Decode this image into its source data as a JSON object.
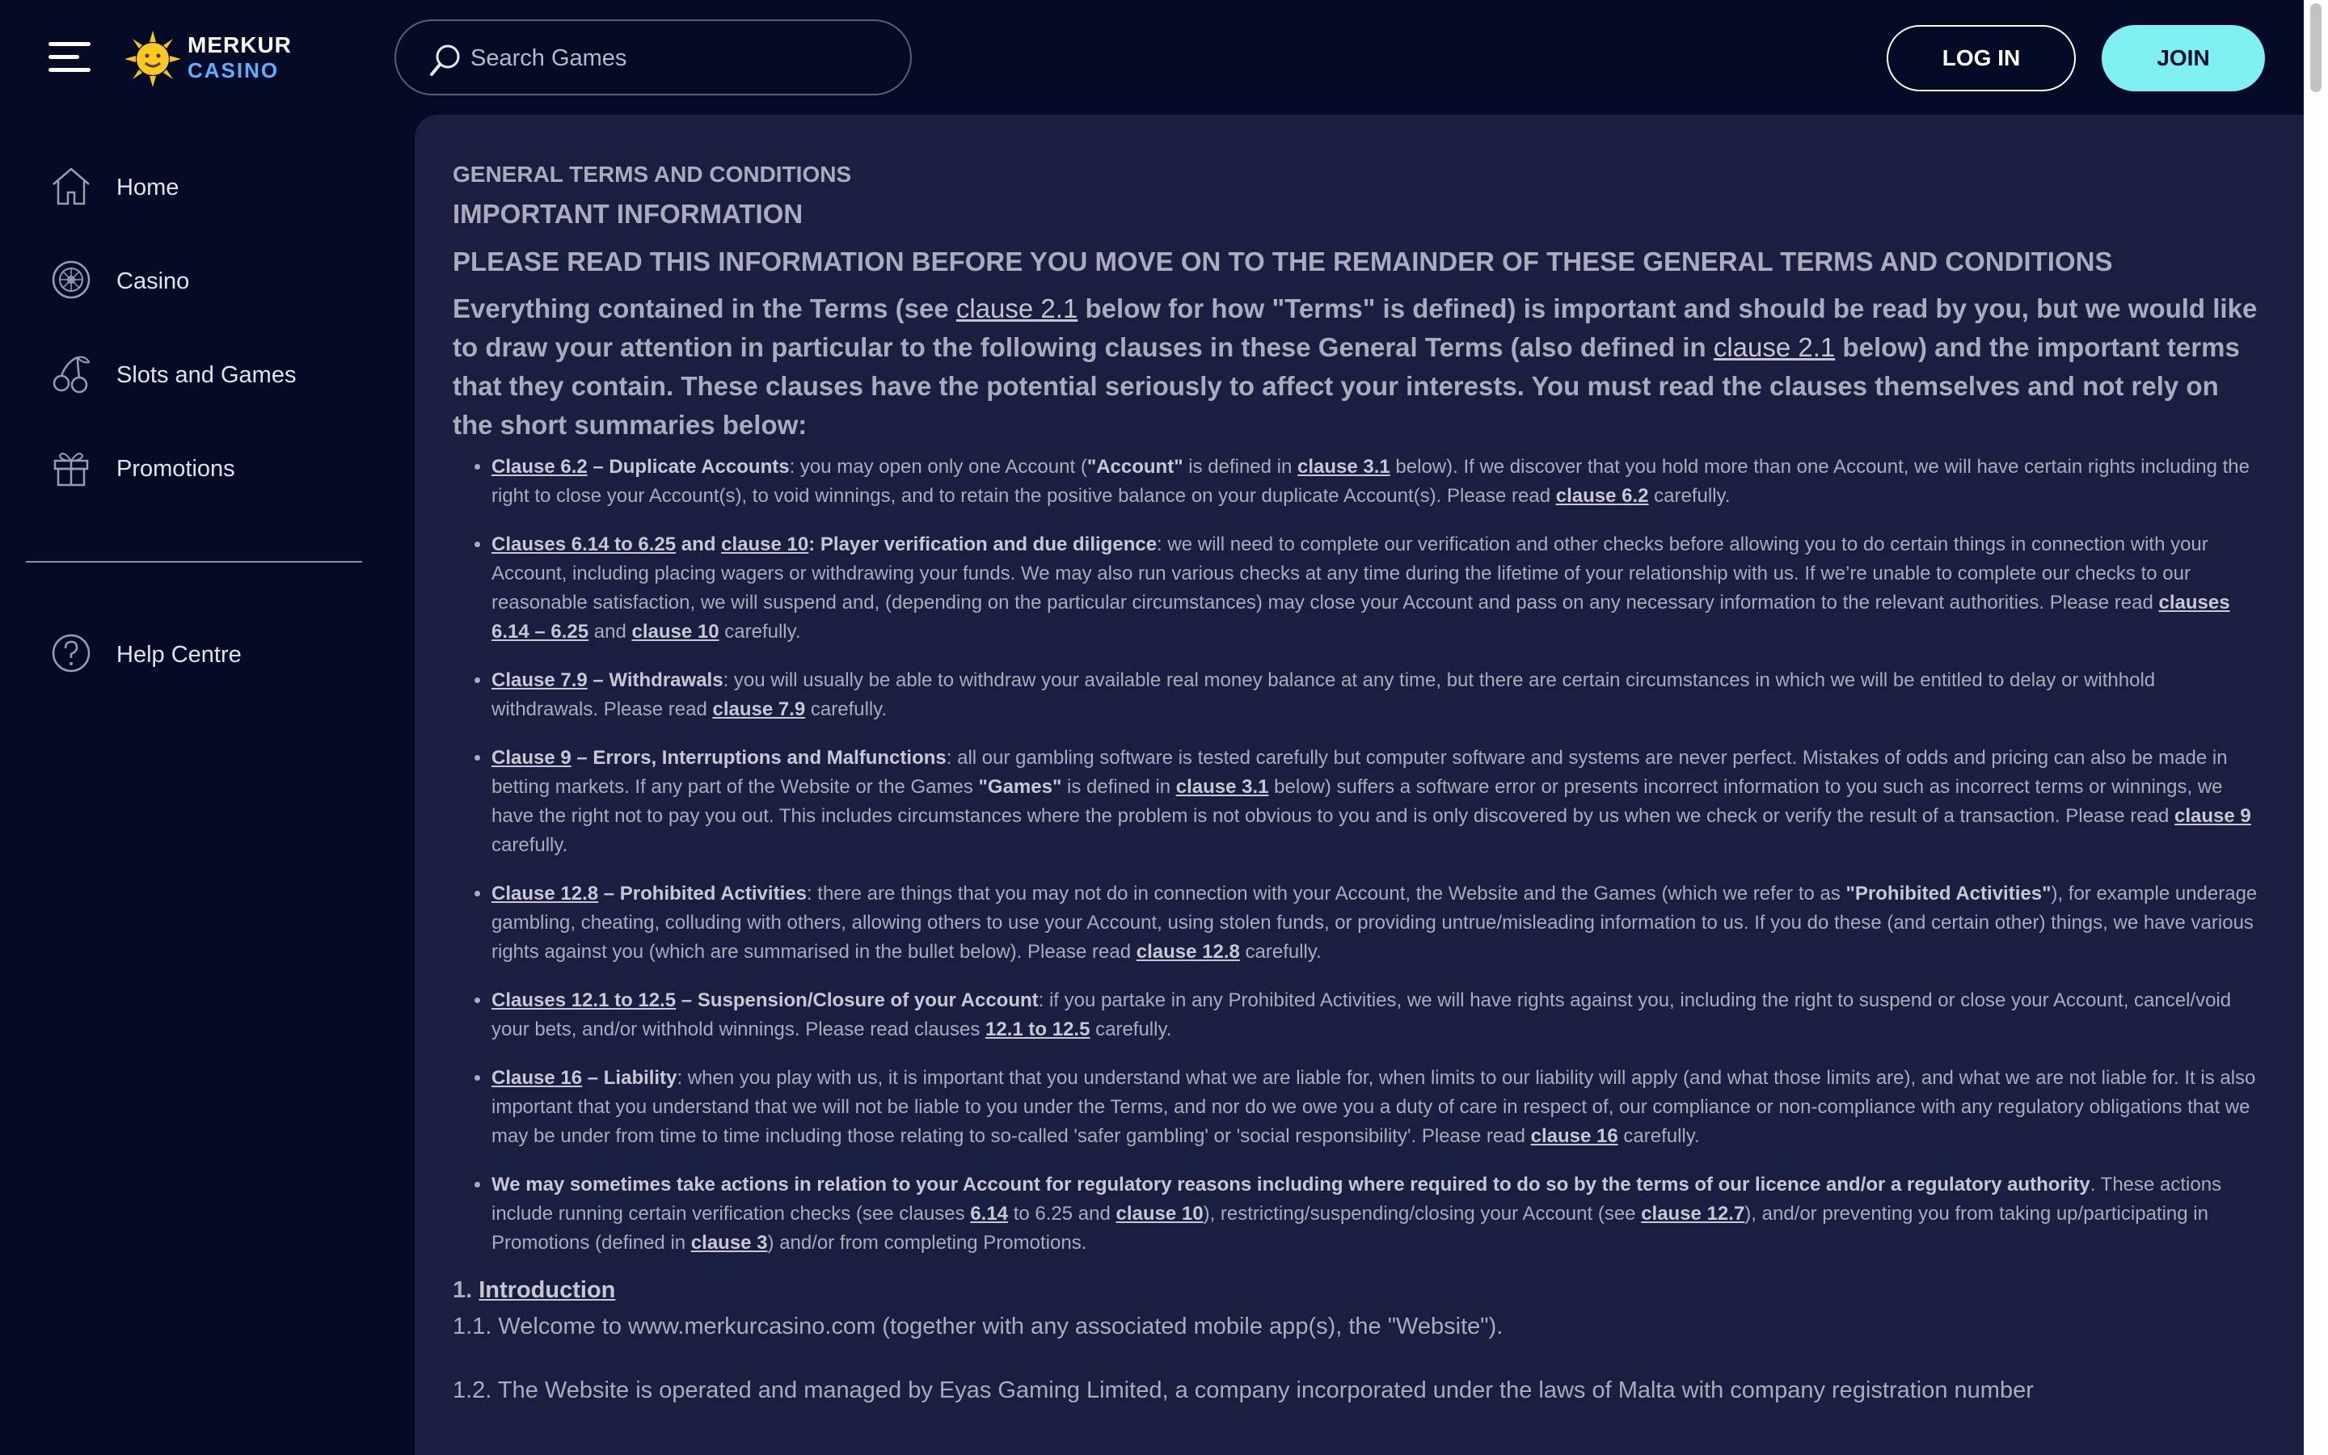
{
  "header": {
    "logo_top": "MERKUR",
    "logo_bottom": "CASINO",
    "search_placeholder": "Search Games",
    "login_label": "LOG IN",
    "join_label": "JOIN"
  },
  "sidebar": {
    "items": [
      {
        "label": "Home",
        "icon": "home-icon"
      },
      {
        "label": "Casino",
        "icon": "roulette-icon"
      },
      {
        "label": "Slots and Games",
        "icon": "cherries-icon"
      },
      {
        "label": "Promotions",
        "icon": "gift-icon"
      }
    ],
    "help": {
      "label": "Help Centre",
      "icon": "help-icon"
    }
  },
  "content": {
    "h1": "GENERAL TERMS AND CONDITIONS",
    "h2": "IMPORTANT INFORMATION",
    "h3": "PLEASE READ THIS INFORMATION BEFORE YOU MOVE ON TO THE REMAINDER OF THESE GENERAL TERMS AND CONDITIONS",
    "intro": {
      "p1": "Everything contained in the Terms (see ",
      "l1": "clause 2.1",
      "p2": " below for how \"Terms\" is defined) is important and should be read by you, but we would like to draw your attention in particular to the following clauses in these General Terms (also defined in ",
      "l2": "clause 2.1",
      "p3": " below) and the important terms that they contain. These clauses have the potential seriously to affect your interests. You must read the clauses themselves and not rely on the short summaries below:"
    },
    "bullets": {
      "b1": {
        "l1": "Clause 6.2",
        "t1": " – Duplicate Accounts",
        "t2": ": you may open only one Account (",
        "t3": "\"Account\"",
        "t4": " is defined in ",
        "l2": "clause 3.1",
        "t5": " below). If we discover that you hold more than one Account, we will have certain rights including the right to close your Account(s), to void winnings, and to retain the positive balance on your duplicate Account(s). Please read ",
        "l3": "clause 6.2",
        "t6": " carefully."
      },
      "b2": {
        "l1": "Clauses 6.14 to 6.25",
        "t1": " and ",
        "l2": "clause 10",
        "t2": ": Player verification and due diligence",
        "t3": ": we will need to complete our verification and other checks before allowing you to do certain things in connection with your Account, including placing wagers or withdrawing your funds. We may also run various checks at any time during the lifetime of your relationship with us. If we’re unable to complete our checks to our reasonable satisfaction, we will suspend and, (depending on the particular circumstances) may close your Account and pass on any necessary information to the relevant authorities. Please read ",
        "l3": "clauses 6.14 – 6.25",
        "t4": " and ",
        "l4": "clause 10",
        "t5": " carefully."
      },
      "b3": {
        "l1": "Clause 7.9",
        "t1": " – Withdrawals",
        "t2": ": you will usually be able to withdraw your available real money balance at any time, but there are certain circumstances in which we will be entitled to delay or withhold withdrawals. Please read ",
        "l2": "clause 7.9",
        "t3": " carefully."
      },
      "b4": {
        "l1": "Clause 9",
        "t1": " – Errors, Interruptions and Malfunctions",
        "t2": ": all our gambling software is tested carefully but computer software and systems are never perfect. Mistakes of odds and pricing can also be made in betting markets. If any part of the Website or the Games ",
        "t3": "\"Games\"",
        "t4": " is defined in ",
        "l2": "clause 3.1",
        "t5": " below) suffers a software error or presents incorrect information to you such as incorrect terms or winnings, we have the right not to pay you out. This includes circumstances where the problem is not obvious to you and is only discovered by us when we check or verify the result of a transaction. Please read ",
        "l3": "clause 9",
        "t6": " carefully."
      },
      "b5": {
        "l1": "Clause 12.8",
        "t1": " – Prohibited Activities",
        "t2": ": there are things that you may not do in connection with your Account, the Website and the Games (which we refer to as ",
        "t3": "\"Prohibited Activities\"",
        "t4": "), for example underage gambling, cheating, colluding with others, allowing others to use your Account, using stolen funds, or providing untrue/misleading information to us. If you do these (and certain other) things, we have various rights against you (which are summarised in the bullet below). Please read ",
        "l2": "clause 12.8",
        "t5": " carefully."
      },
      "b6": {
        "l1": "Clauses 12.1 to 12.5",
        "t1": " – Suspension/Closure of your Account",
        "t2": ": if you partake in any Prohibited Activities, we will have rights against you, including the right to suspend or close your Account, cancel/void your bets, and/or withhold winnings. Please read clauses ",
        "l2": "12.1 to 12.5",
        "t3": " carefully."
      },
      "b7": {
        "l1": "Clause 16",
        "t1": " – Liability",
        "t2": ": when you play with us, it is important that you understand what we are liable for, when limits to our liability will apply (and what those limits are), and what we are not liable for. It is also important that you understand that we will not be liable to you under the Terms, and nor do we owe you a duty of care in respect of, our compliance or non-compliance with any regulatory obligations that we may be under from time to time including those relating to so-called 'safer gambling' or 'social responsibility'. Please read ",
        "l2": "clause 16",
        "t3": " carefully."
      },
      "b8": {
        "t1": "We may sometimes take actions in relation to your Account for regulatory reasons including where required to do so by the terms of our licence and/or a regulatory authority",
        "t2": ". These actions include running certain verification checks (see clauses ",
        "l1": "6.14",
        "t3": " to 6.25 and ",
        "l2": "clause 10",
        "t4": "), restricting/suspending/closing your Account (see ",
        "l3": "clause 12.7",
        "t5": "), and/or preventing you from taking up/participating in Promotions (defined in ",
        "l4": "clause 3",
        "t6": ") and/or from completing Promotions."
      }
    },
    "section1": {
      "num": "1. ",
      "title": "Introduction"
    },
    "p11": "1.1. Welcome to www.merkurcasino.com (together with any associated mobile app(s), the \"Website\").",
    "p12": "1.2. The Website is operated and managed by Eyas Gaming Limited, a company incorporated under the laws of Malta with company registration number"
  }
}
